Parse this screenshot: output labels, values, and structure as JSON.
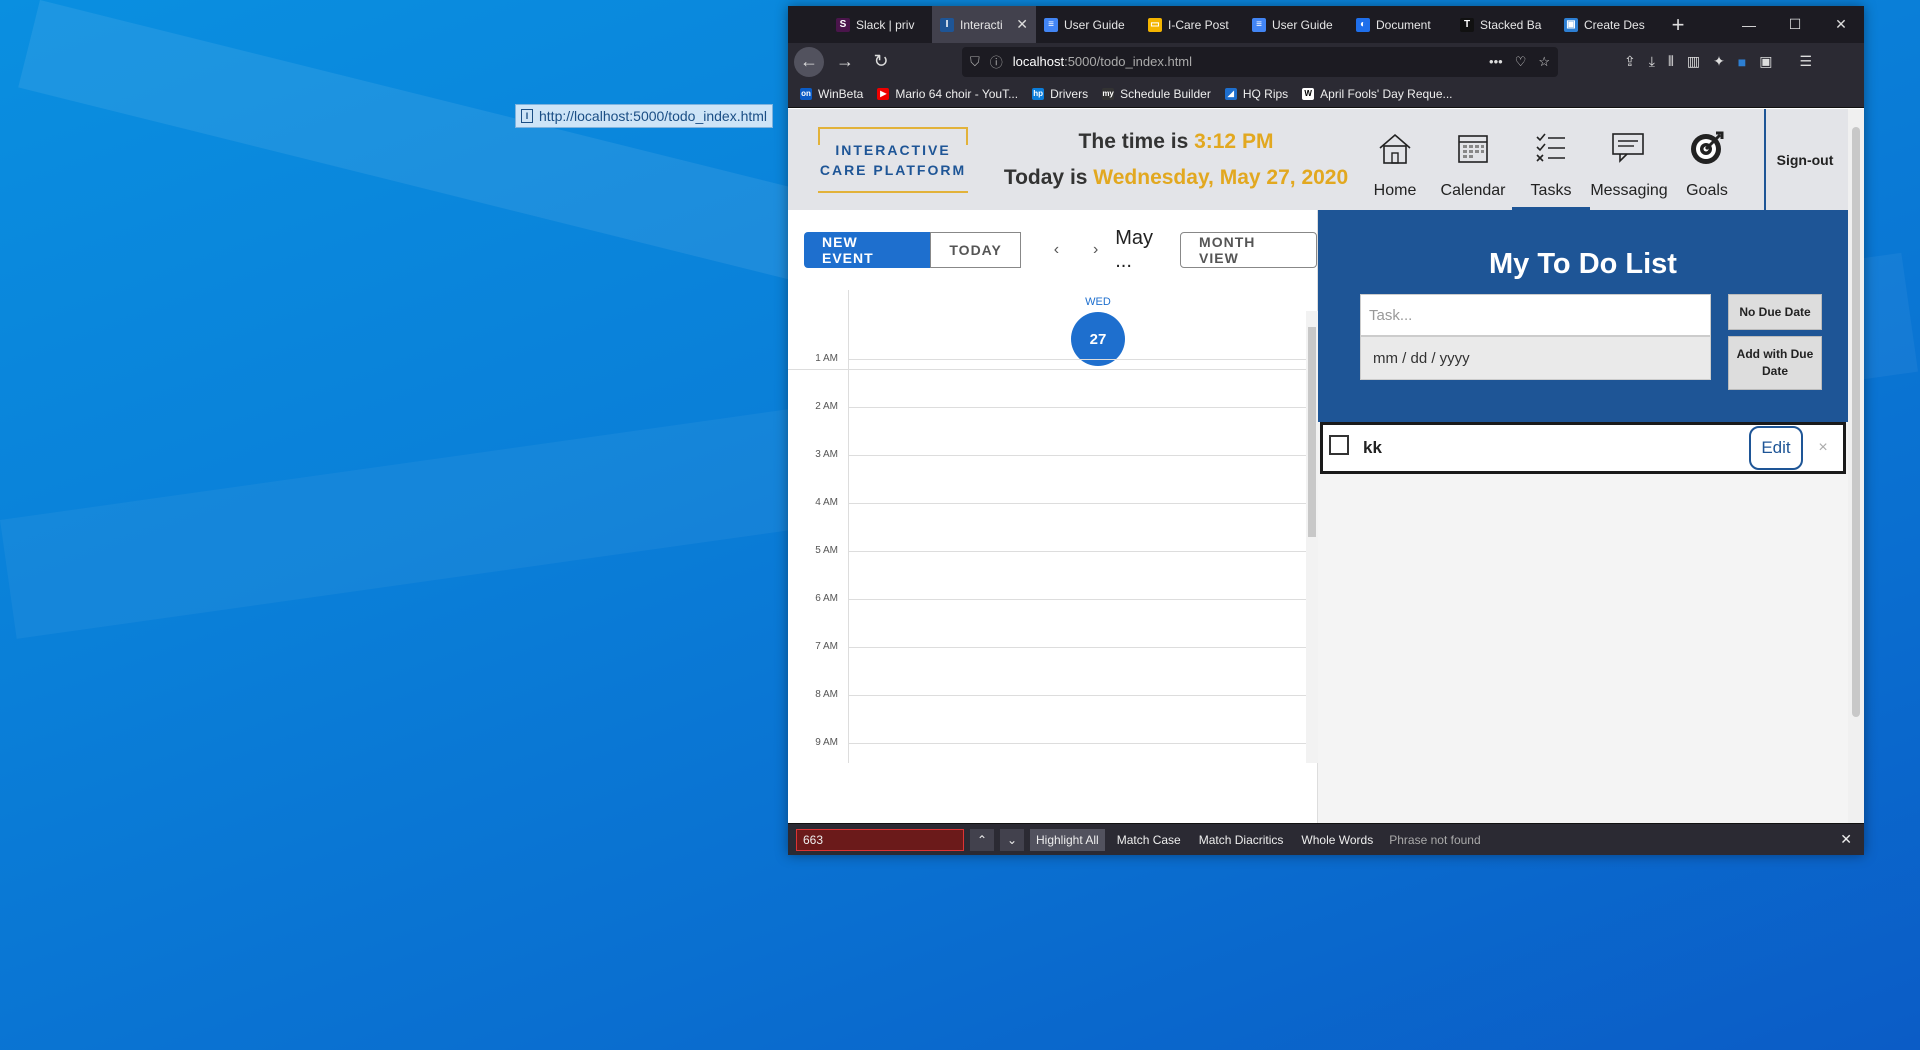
{
  "desktop": {
    "drag_link": "http://localhost:5000/todo_index.html"
  },
  "browser": {
    "tabs": [
      {
        "label": "Slack | priv",
        "fav": "S",
        "color": "#4a154b"
      },
      {
        "label": "Interacti",
        "fav": "I",
        "color": "#1e5596",
        "active": true
      },
      {
        "label": "User Guide",
        "fav": "≡",
        "color": "#4285f4"
      },
      {
        "label": "I-Care Post",
        "fav": "▭",
        "color": "#f4b400"
      },
      {
        "label": "User Guide",
        "fav": "≡",
        "color": "#4285f4"
      },
      {
        "label": "Document",
        "fav": "◐",
        "color": "#1f6feb"
      },
      {
        "label": "Stacked Ba",
        "fav": "T",
        "color": "#111111"
      },
      {
        "label": "Create Des",
        "fav": "▣",
        "color": "#2d7fd3"
      }
    ],
    "url_host": "localhost",
    "url_path": ":5000/todo_index.html",
    "bookmarks": [
      {
        "label": "WinBeta",
        "color": "#0b5cc6",
        "fav": "on"
      },
      {
        "label": "Mario 64 choir - YouT...",
        "color": "#e00",
        "fav": "▶"
      },
      {
        "label": "Drivers",
        "color": "#0b7dda",
        "fav": "hp"
      },
      {
        "label": "Schedule Builder",
        "color": "#333",
        "fav": "my"
      },
      {
        "label": "HQ Rips",
        "color": "#1e6fce",
        "fav": "◢"
      },
      {
        "label": "April Fools' Day Reque...",
        "color": "#fff",
        "fav": "W"
      }
    ]
  },
  "header": {
    "logo": "INTERACTIVE CARE PLATFORM",
    "time_prefix": "The time is ",
    "time": "3:12 PM",
    "date_prefix": "Today is ",
    "date": "Wednesday, May 27, 2020",
    "nav": [
      "Home",
      "Calendar",
      "Tasks",
      "Messaging",
      "Goals"
    ],
    "signout": "Sign-out"
  },
  "calendar": {
    "new_event": "NEW EVENT",
    "today": "TODAY",
    "prev": "‹",
    "next": "›",
    "month": "May ...",
    "month_view": "MONTH VIEW",
    "dow": "WED",
    "day": "27",
    "hours": [
      "1 AM",
      "2 AM",
      "3 AM",
      "4 AM",
      "5 AM",
      "6 AM",
      "7 AM",
      "8 AM",
      "9 AM"
    ]
  },
  "todo": {
    "title": "My To Do List",
    "task_placeholder": "Task...",
    "date_placeholder": "mm / dd / yyyy",
    "no_due": "No Due Date",
    "add_due": "Add with Due Date",
    "items": [
      {
        "text": "kk",
        "edit": "Edit",
        "delete": "×"
      }
    ]
  },
  "findbar": {
    "query": "663",
    "highlight_all": "Highlight All",
    "match_case": "Match Case",
    "match_diacritics": "Match Diacritics",
    "whole_words": "Whole Words",
    "status": "Phrase not found"
  }
}
